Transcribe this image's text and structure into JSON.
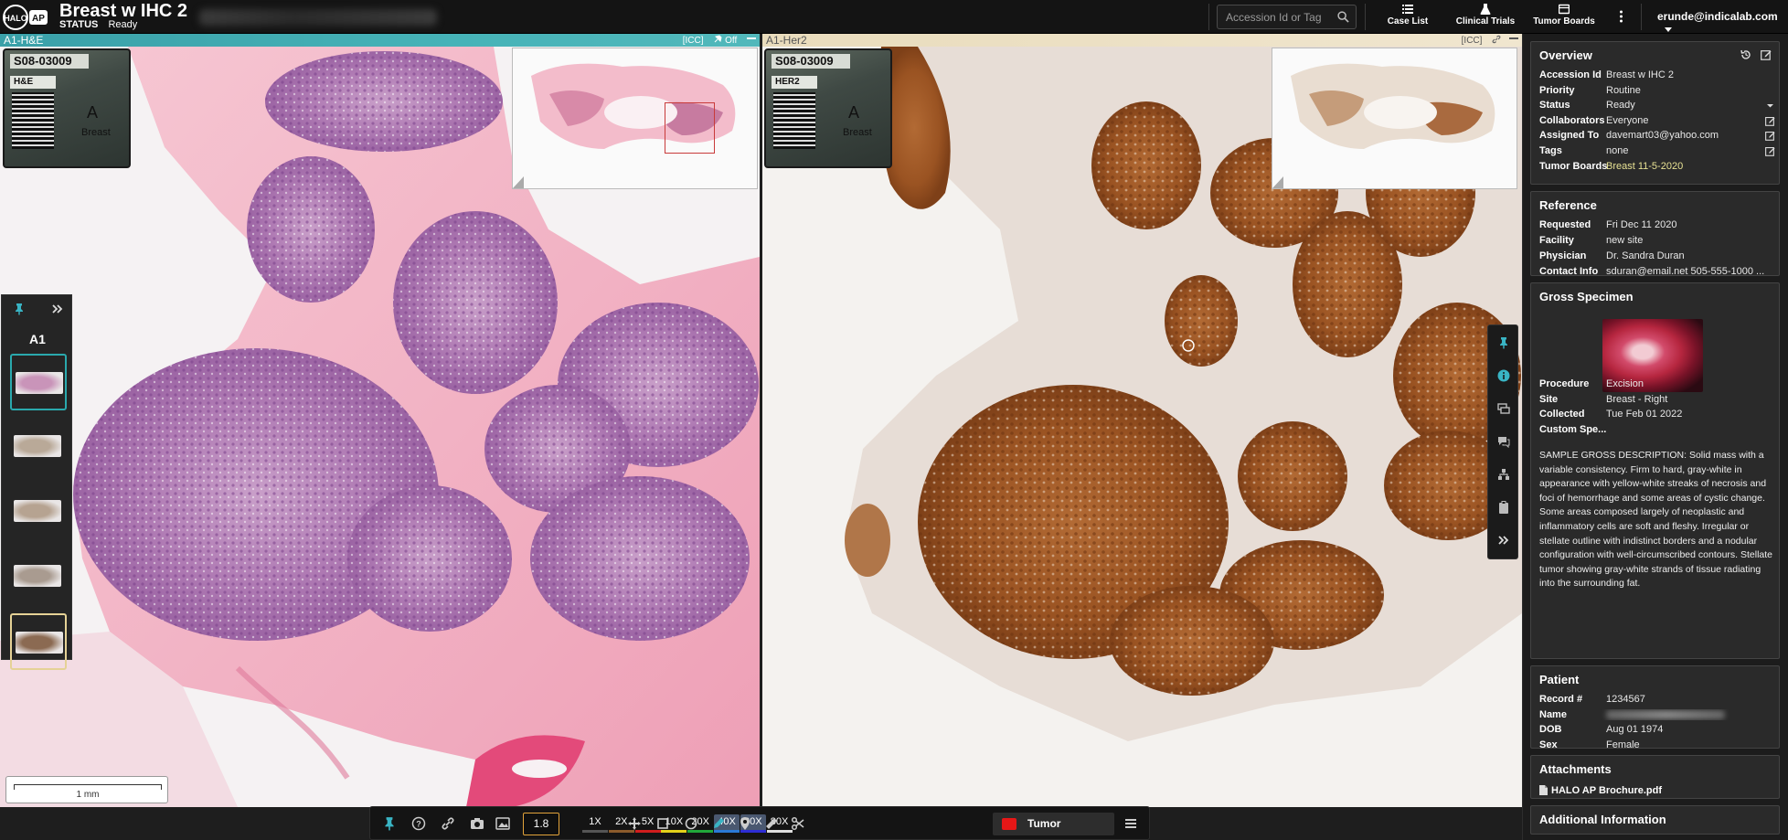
{
  "header": {
    "app_title": "Breast w IHC 2",
    "status_label": "STATUS",
    "status_value": "Ready",
    "search_placeholder": "Accession Id or Tag",
    "nav": [
      {
        "label": "Case List",
        "icon": "list-icon"
      },
      {
        "label": "Clinical Trials",
        "icon": "flask-icon"
      },
      {
        "label": "Tumor Boards",
        "icon": "board-icon"
      }
    ],
    "user_email": "erunde@indicalab.com"
  },
  "viewers": [
    {
      "header_label": "A1-H&E",
      "header_controls": "[ICC]",
      "header_extra": "Off",
      "slide_label_id": "S08-03009",
      "slide_label_stain": "H&E",
      "slide_label_letter": "A",
      "slide_label_site": "Breast",
      "stain": "he"
    },
    {
      "header_label": "A1-Her2",
      "header_controls": "[ICC]",
      "slide_label_id": "S08-03009",
      "slide_label_stain": "HER2",
      "slide_label_letter": "A",
      "slide_label_site": "Breast",
      "stain": "her2"
    }
  ],
  "slide_tray": {
    "group_label": "A1",
    "thumbs": [
      {
        "name": "he",
        "color": "#c994b9"
      },
      {
        "name": "ihc-1",
        "color": "#b9a998"
      },
      {
        "name": "ihc-2",
        "color": "#b6a391"
      },
      {
        "name": "ihc-3",
        "color": "#a99b90"
      },
      {
        "name": "her2",
        "color": "#8b6a52"
      }
    ]
  },
  "scalebar": {
    "label": "1 mm"
  },
  "toolbar": {
    "zoom_value": "1.8",
    "magnifications": [
      {
        "label": "1X",
        "color": "#555555"
      },
      {
        "label": "2X",
        "color": "#8b5a2b"
      },
      {
        "label": "5X",
        "color": "#d11d1d"
      },
      {
        "label": "10X",
        "color": "#e2d21a"
      },
      {
        "label": "20X",
        "color": "#21a83a"
      },
      {
        "label": "40X",
        "color": "#2a79d6",
        "active": true
      },
      {
        "label": "60X",
        "color": "#2d2dd6",
        "active": true
      },
      {
        "label": "80X",
        "color": "#dddddd"
      }
    ],
    "annotation_class": "Tumor",
    "annotation_color": "#e61717"
  },
  "info": {
    "overview": {
      "title": "Overview",
      "rows": [
        {
          "k": "Accession Id",
          "v": "Breast w IHC 2"
        },
        {
          "k": "Priority",
          "v": "Routine"
        },
        {
          "k": "Status",
          "v": "Ready"
        },
        {
          "k": "Collaborators",
          "v": "Everyone"
        },
        {
          "k": "Assigned To",
          "v": "davemart03@yahoo.com"
        },
        {
          "k": "Tags",
          "v": "none"
        },
        {
          "k": "Tumor Boards",
          "v": "Breast 11-5-2020"
        }
      ]
    },
    "reference": {
      "title": "Reference",
      "rows": [
        {
          "k": "Requested",
          "v": "Fri Dec 11 2020"
        },
        {
          "k": "Facility",
          "v": "new site"
        },
        {
          "k": "Physician",
          "v": "Dr. Sandra Duran"
        },
        {
          "k": "Contact Info",
          "v": "sduran@email.net 505-555-1000 ..."
        }
      ]
    },
    "gross": {
      "title": "Gross Specimen",
      "rows": [
        {
          "k": "Procedure",
          "v": "Excision"
        },
        {
          "k": "Site",
          "v": "Breast - Right"
        },
        {
          "k": "Collected",
          "v": "Tue Feb 01 2022"
        },
        {
          "k": "Custom Spe...",
          "v": ""
        }
      ],
      "description": "SAMPLE GROSS DESCRIPTION: Solid mass with a variable consistency. Firm to hard, gray-white in appearance with yellow-white streaks of necrosis and foci of hemorrhage and some areas of cystic change. Some areas composed largely of neoplastic and inflammatory cells are soft and fleshy. Irregular or stellate outline with indistinct borders and a nodular configuration with well-circumscribed contours. Stellate tumor showing gray-white strands of tissue radiating into the surrounding fat."
    },
    "patient": {
      "title": "Patient",
      "rows": [
        {
          "k": "Record #",
          "v": "1234567"
        },
        {
          "k": "Name",
          "v": ""
        },
        {
          "k": "DOB",
          "v": "Aug 01 1974"
        },
        {
          "k": "Sex",
          "v": "Female"
        }
      ]
    },
    "attachments": {
      "title": "Attachments",
      "file": "HALO AP Brochure.pdf"
    },
    "additional": {
      "title": "Additional Information"
    }
  }
}
